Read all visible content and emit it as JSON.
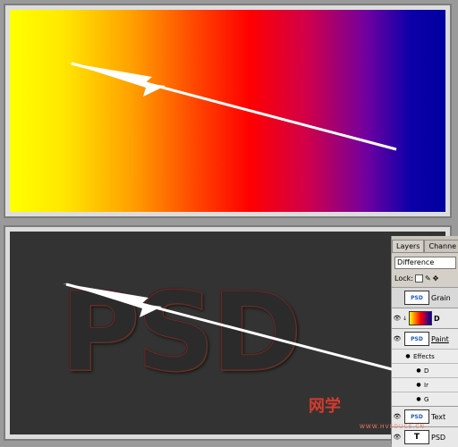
{
  "layers_panel": {
    "tabs": [
      "Layers",
      "Channe"
    ],
    "blend_mode": "Difference",
    "lock_label": "Lock:",
    "items": [
      {
        "name": "Grain",
        "visible": false
      },
      {
        "name": "D",
        "visible": true
      },
      {
        "name": "Paint",
        "visible": true
      },
      {
        "name": "Effects"
      },
      {
        "name": "D"
      },
      {
        "name": "Ir"
      },
      {
        "name": "G"
      },
      {
        "name": "Text",
        "visible": true
      },
      {
        "name": "PSD",
        "visible": true
      }
    ],
    "type_glyph": "T"
  },
  "canvas": {
    "text": "PSD",
    "gradient_colors": [
      "#ffff00",
      "#ff0000",
      "#0000a0"
    ]
  },
  "watermark": {
    "text": "网学",
    "url": "WWW.HVEDUCS.CN"
  }
}
